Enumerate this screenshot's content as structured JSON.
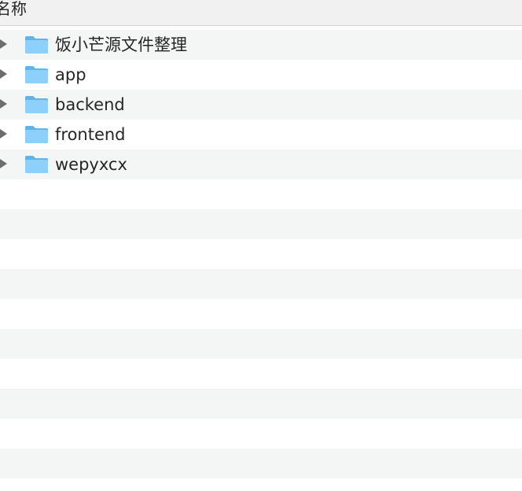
{
  "header": {
    "name_column": "名称"
  },
  "items": [
    {
      "name": "饭小芒源文件整理",
      "icon": "folder-icon"
    },
    {
      "name": "app",
      "icon": "folder-icon"
    },
    {
      "name": "backend",
      "icon": "folder-icon"
    },
    {
      "name": "frontend",
      "icon": "folder-icon"
    },
    {
      "name": "wepyxcx",
      "icon": "folder-icon"
    }
  ],
  "colors": {
    "folder": "#7fc8f8",
    "row_alt": "#f4f5f5",
    "header_bg": "#f1f1f1"
  }
}
